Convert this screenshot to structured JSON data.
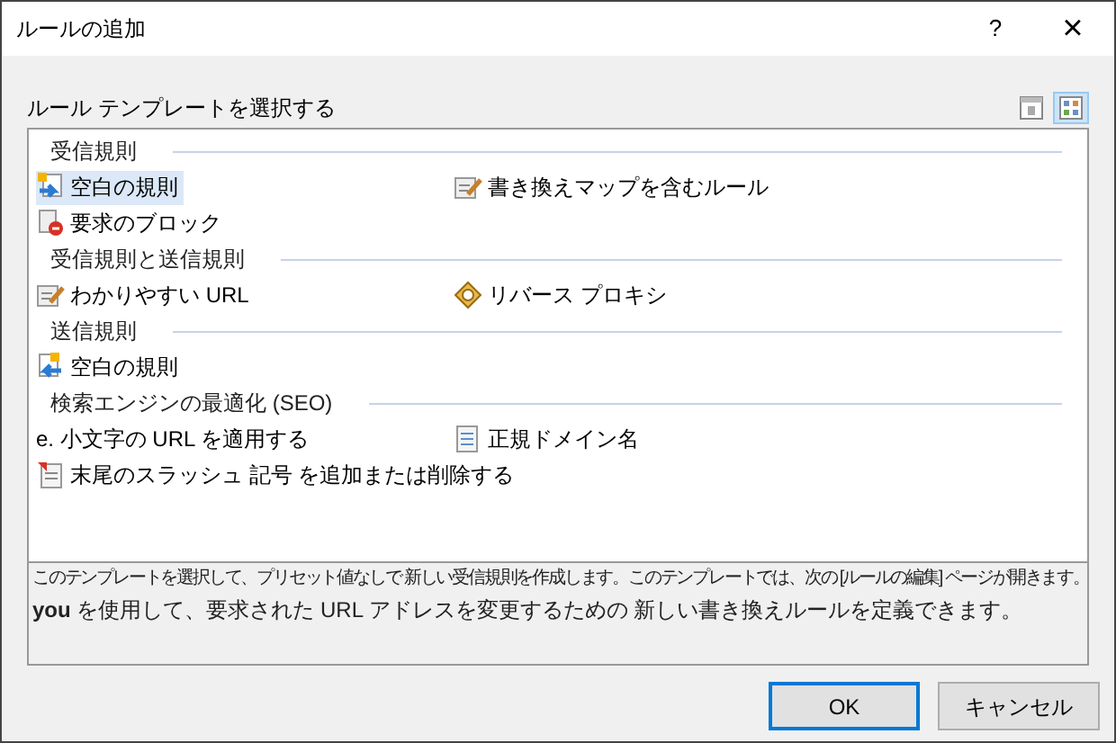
{
  "window": {
    "title": "ルールの追加",
    "help": "?",
    "close": "×"
  },
  "template_label": "ルール テンプレートを選択する",
  "view_buttons": [
    {
      "kind": "details",
      "selected": false
    },
    {
      "kind": "tiles",
      "selected": true
    }
  ],
  "groups": [
    {
      "title": "受信規則",
      "items": [
        {
          "label": "空白の規則",
          "kind": "inbound",
          "selected": true
        },
        {
          "label": "書き換えマップを含むルール",
          "kind": "map",
          "selected": false
        },
        {
          "label": "要求のブロック",
          "kind": "block",
          "selected": false
        }
      ]
    },
    {
      "title": "受信規則と送信規則",
      "items": [
        {
          "label": "わかりやすい URL",
          "kind": "edit",
          "selected": false
        },
        {
          "label": "リバース プロキシ",
          "kind": "proxy",
          "selected": false
        }
      ]
    },
    {
      "title": "送信規則",
      "items": [
        {
          "label": "空白の規則",
          "kind": "outbound",
          "selected": false
        }
      ]
    },
    {
      "title": "検索エンジンの最適化 (SEO)",
      "items": [
        {
          "label": "e. 小文字の URL を適用する",
          "kind": "none",
          "selected": false
        },
        {
          "label": "正規ドメイン名",
          "kind": "document",
          "selected": false
        },
        {
          "label": "末尾のスラッシュ 記号 を追加または削除する",
          "kind": "slash",
          "selected": false
        }
      ]
    }
  ],
  "description": [
    "このテンプレートを選択して、プリセット値なしで 新しい受信規則を作成します。このテンプレートでは、次の [ルールの編集] ページが開きます。",
    "**you** を使用して、要求された URL アドレスを変更するための 新しい書き換えルールを定義できます。"
  ],
  "buttons": [
    {
      "label": "OK",
      "kind": "default"
    },
    {
      "label": "キャンセル",
      "kind": "normal"
    }
  ]
}
